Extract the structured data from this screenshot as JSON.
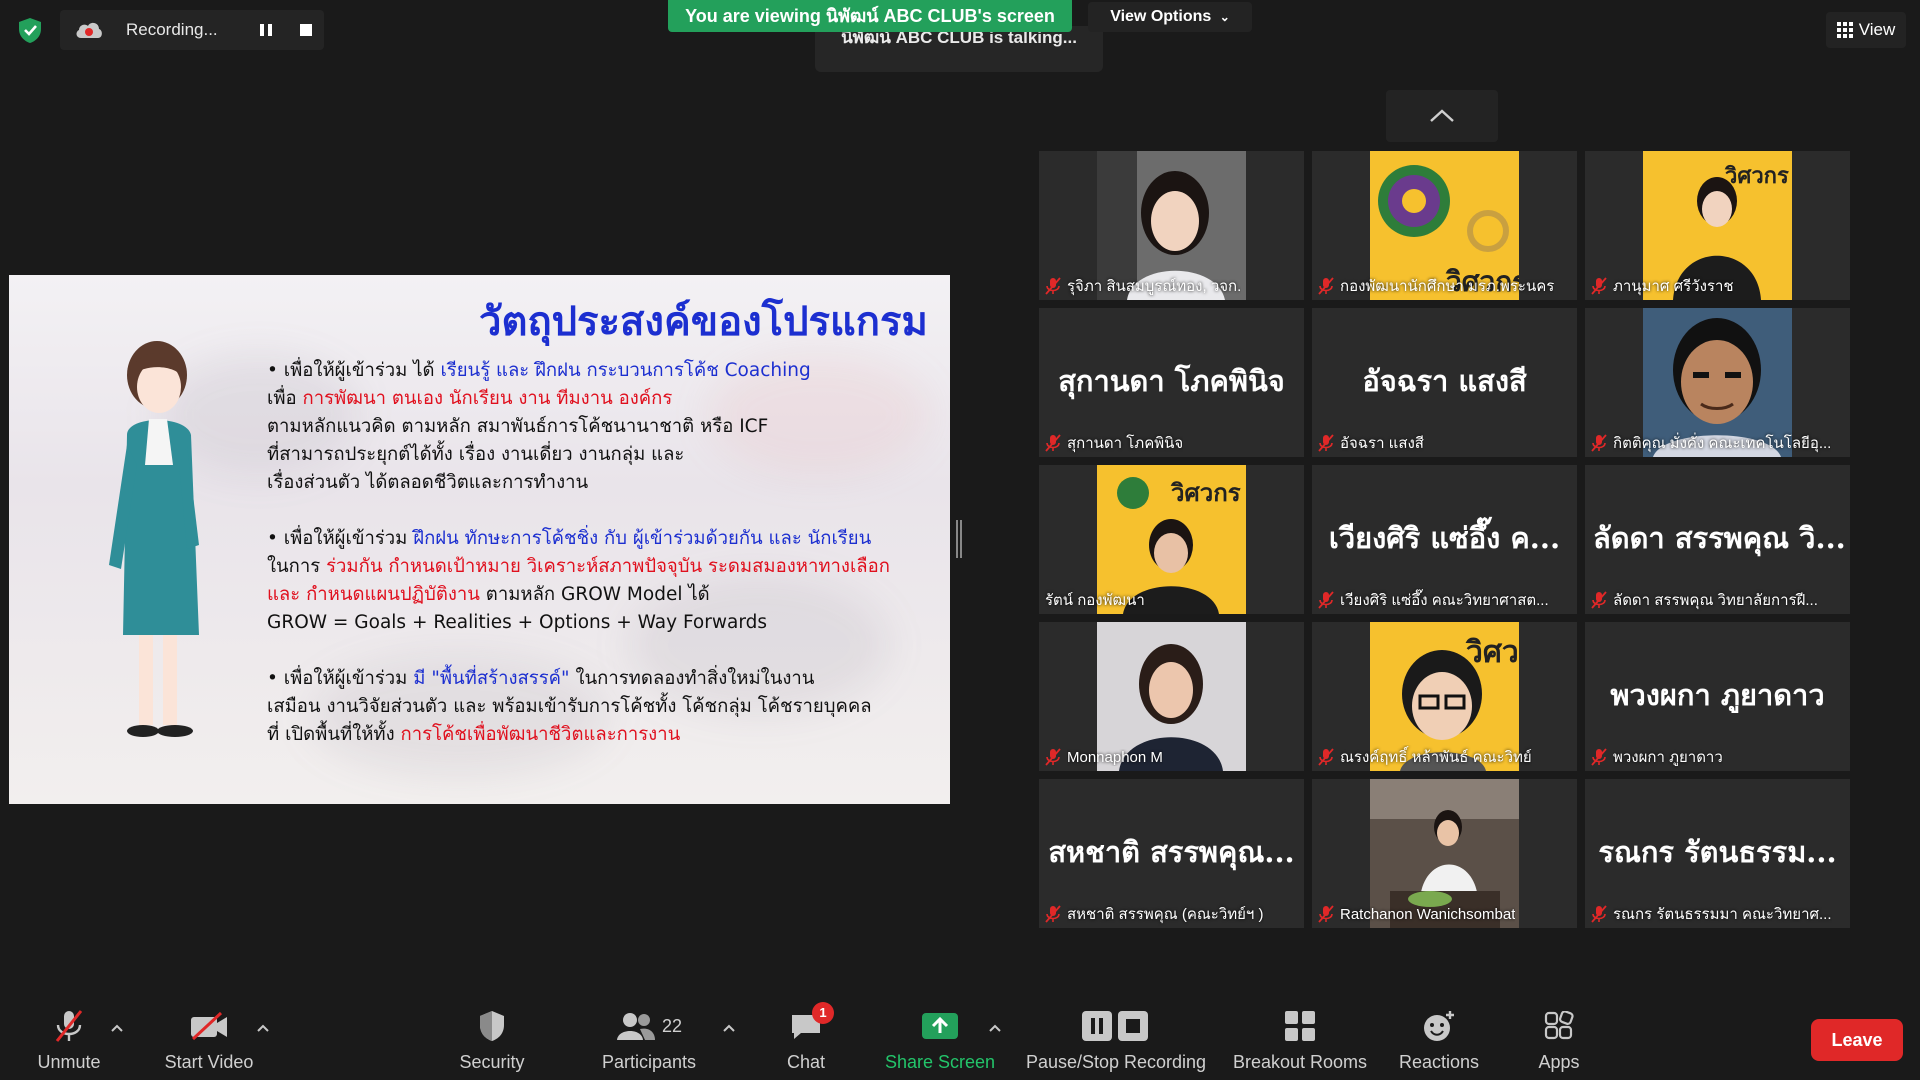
{
  "colors": {
    "accent_green": "#23a05b",
    "leave_red": "#e02828",
    "mute_red": "#e02828",
    "slide_blue": "#1c2fd0",
    "slide_red": "#e0101e"
  },
  "top": {
    "recording_label": "Recording...",
    "viewing_banner": "You are viewing นิพัฒน์ ABC CLUB's screen",
    "view_options": "View Options",
    "talking": "นิพัฒน์ ABC CLUB is talking...",
    "view_label": "View"
  },
  "slide": {
    "title": "วัตถุประสงค์ของโปรแกรม",
    "p1": {
      "a": "• เพื่อให้ผู้เข้าร่วม ได้ ",
      "b": "เรียนรู้ และ ฝึกฝน กระบวนการโค้ช Coaching",
      "c": "เพื่อ ",
      "d": "การพัฒนา ตนเอง นักเรียน งาน ทีมงาน องค์กร",
      "e": "ตามหลักแนวคิด ตามหลัก สมาพันธ์การโค้ชนานาชาติ หรือ ICF",
      "f": "ที่สามารถประยุกต์ได้ทั้ง เรื่อง งานเดี่ยว งานกลุ่ม และ",
      "g": "เรื่องส่วนตัว ได้ตลอดชีวิตและการทำงาน"
    },
    "p2": {
      "a": "• เพื่อให้ผู้เข้าร่วม ",
      "b": "ฝึกฝน ทักษะการโค้ชชิ่ง กับ ผู้เข้าร่วมด้วยกัน และ นักเรียน",
      "c": "ในการ ",
      "d": "ร่วมกัน กำหนดเป้าหมาย วิเคราะห์สภาพปัจจุบัน ระดมสมองหาทางเลือก",
      "e": "และ กำหนดแผนปฏิบัติงาน",
      "f": " ตามหลัก GROW Model ได้",
      "g": "GROW = Goals + Realities + Options + Way Forwards"
    },
    "p3": {
      "a": "• เพื่อให้ผู้เข้าร่วม ",
      "b": "มี \"พื้นที่สร้างสรรค์\"",
      "c": " ในการทดลองทำสิ่งใหม่ในงาน",
      "d": "เสมือน งานวิจัยส่วนตัว และ พร้อมเข้ารับการโค้ชทั้ง โค้ชกลุ่ม โค้ชรายบุคคล",
      "e": "ที่ เปิดพื้นที่ให้ทั้ง ",
      "f": "การโค้ชเพื่อพัฒนาชีวิตและการงาน"
    }
  },
  "gallery": [
    {
      "caption": "รุจิภา สินสมบูรณ์ทอง, วจก.",
      "big": ""
    },
    {
      "caption": "กองพัฒนานักศึกษา มรภ.พระนคร",
      "big": ""
    },
    {
      "caption": "ภานุมาศ ศรีวังราช",
      "big": ""
    },
    {
      "caption": "สุกานดา โภคพินิจ",
      "big": "สุกานดา โภคพินิจ"
    },
    {
      "caption": "อัจฉรา แสงสี",
      "big": "อัจฉรา แสงสี"
    },
    {
      "caption": "กิตติคุณ มั่งคั่ง คณะเทคโนโลยีอุ...",
      "big": ""
    },
    {
      "caption": "รัตน์ กองพัฒนา",
      "big": ""
    },
    {
      "caption": "เวียงศิริ แซ่อึ๊ง คณะวิทยาศาสต...",
      "big": "เวียงศิริ แซ่อึ๊ง ค..."
    },
    {
      "caption": "ลัดดา สรรพคุณ วิทยาลัยการฝี...",
      "big": "ลัดดา สรรพคุณ วิ..."
    },
    {
      "caption": "Monnaphon M",
      "big": ""
    },
    {
      "caption": "ณรงค์ฤทธิ์ หล้าพันธ์ คณะวิทย์",
      "big": ""
    },
    {
      "caption": "พวงผกา ภูยาดาว",
      "big": "พวงผกา ภูยาดาว"
    },
    {
      "caption": "สหชาติ สรรพคุณ (คณะวิทย์ฯ )",
      "big": "สหชาติ สรรพคุณ..."
    },
    {
      "caption": "Ratchanon Wanichsombat",
      "big": ""
    },
    {
      "caption": "รณกร รัตนธรรมมา คณะวิทยาศ...",
      "big": "รณกร รัตนธรรม..."
    }
  ],
  "toolbar": {
    "unmute": "Unmute",
    "start_video": "Start Video",
    "security": "Security",
    "participants": "Participants",
    "participants_count": "22",
    "chat": "Chat",
    "chat_badge": "1",
    "share_screen": "Share Screen",
    "pause_stop": "Pause/Stop Recording",
    "breakout": "Breakout Rooms",
    "reactions": "Reactions",
    "apps": "Apps",
    "leave": "Leave"
  },
  "icons": [
    "shield-check-icon",
    "recording-cloud-icon",
    "pause-icon",
    "stop-icon",
    "chevron-down-icon",
    "grid-icon",
    "chevron-up-icon",
    "mic-muted-icon",
    "video-off-icon",
    "security-shield-icon",
    "participants-icon",
    "chat-icon",
    "share-screen-icon",
    "pause-stop-icon",
    "breakout-icon",
    "reactions-icon",
    "apps-icon"
  ]
}
